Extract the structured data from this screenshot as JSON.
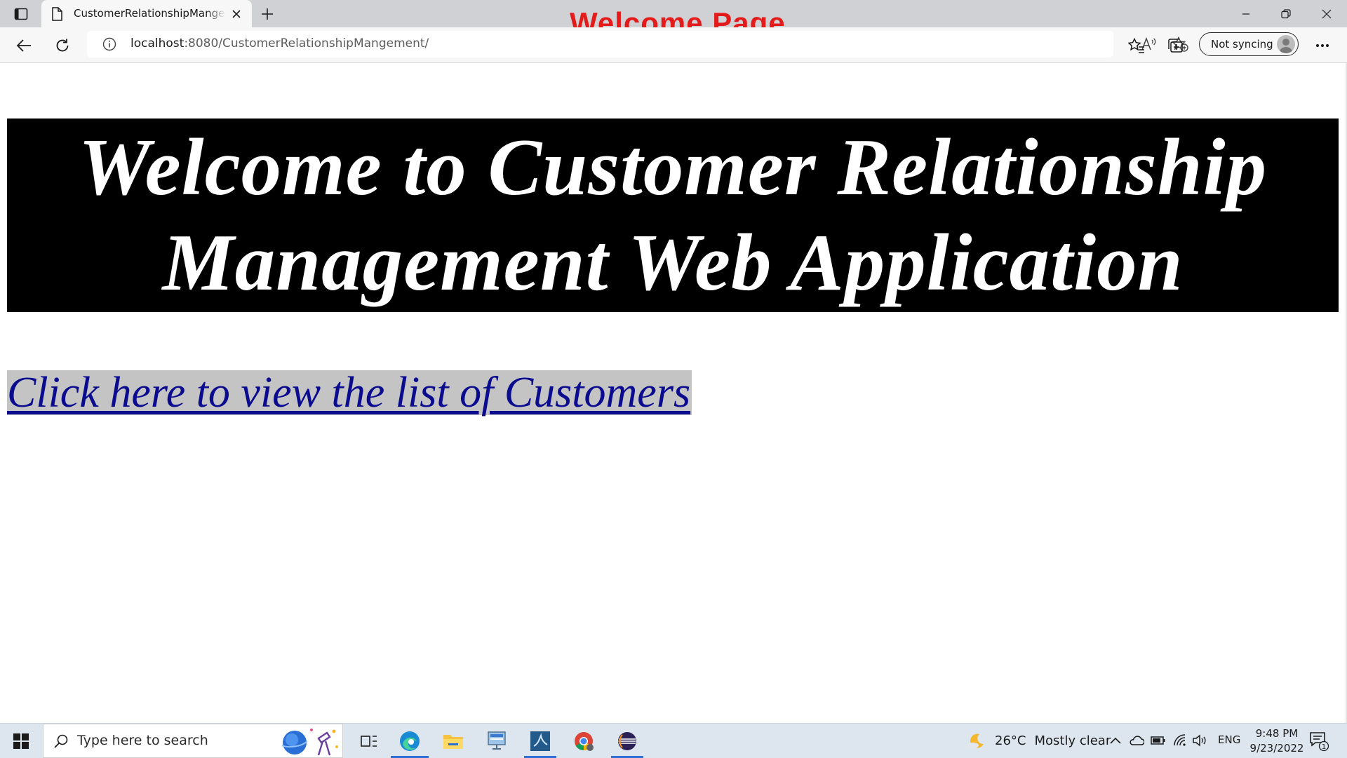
{
  "window": {
    "overlay_title": "Welcome Page"
  },
  "tab": {
    "title": "CustomerRelationshipMangement",
    "favicon": "page-icon"
  },
  "address": {
    "host": "localhost",
    "path": ":8080/CustomerRelationshipMangement/"
  },
  "toolbar": {
    "profile_label": "Not syncing"
  },
  "page": {
    "banner_heading": "Welcome to Customer Relationship Management Web Application",
    "customers_link": "Click here to view the list of Customers"
  },
  "taskbar": {
    "search_placeholder": "Type here to search",
    "weather_temp": "26°C",
    "weather_desc": "Mostly clear",
    "language": "ENG",
    "time": "9:48 PM",
    "date": "9/23/2022",
    "notification_count": "1"
  },
  "colors": {
    "overlay_title": "#e41b1b",
    "banner_bg": "#000000",
    "banner_text": "#ffffff",
    "link_text": "#0b0b8f",
    "link_highlight": "#c4c4c4"
  }
}
